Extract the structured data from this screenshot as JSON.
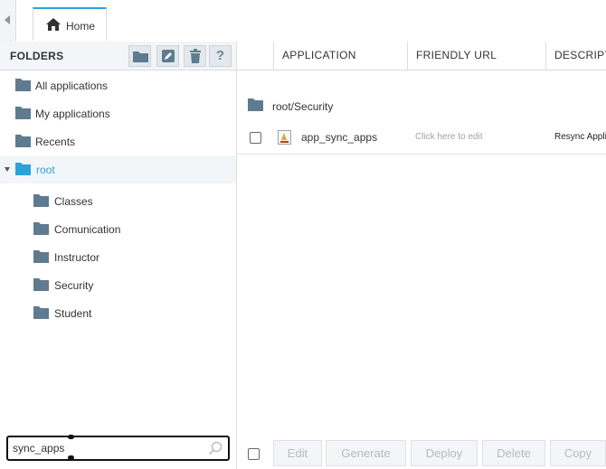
{
  "tabs": [
    {
      "label": "Home",
      "icon": "home-icon"
    }
  ],
  "sidebar": {
    "title": "FOLDERS",
    "tools": [
      {
        "name": "new-folder-button",
        "icon": "folder-icon"
      },
      {
        "name": "edit-folder-button",
        "icon": "pencil-icon"
      },
      {
        "name": "delete-folder-button",
        "icon": "trash-icon"
      },
      {
        "name": "help-button",
        "icon": "question-icon",
        "label": "?"
      }
    ],
    "items": [
      {
        "label": "All applications"
      },
      {
        "label": "My applications"
      },
      {
        "label": "Recents"
      },
      {
        "label": "root",
        "selected": true,
        "expanded": true
      },
      {
        "label": "Classes"
      },
      {
        "label": "Comunication"
      },
      {
        "label": "Instructor"
      },
      {
        "label": "Security"
      },
      {
        "label": "Student"
      }
    ],
    "search": {
      "value": "sync_apps",
      "placeholder": ""
    }
  },
  "grid": {
    "columns": [
      "APPLICATION",
      "FRIENDLY URL",
      "DESCRIPTION"
    ],
    "group_label": "root/Security",
    "rows": [
      {
        "application": "app_sync_apps",
        "friendly_url": "Click here to edit",
        "description": "Resync Applications"
      }
    ]
  },
  "actions": [
    "Edit",
    "Generate",
    "Deploy",
    "Delete",
    "Copy"
  ],
  "colors": {
    "accent": "#27a4dd",
    "folder": "#5f7b8f",
    "selected_text": "#2aa3d8"
  }
}
